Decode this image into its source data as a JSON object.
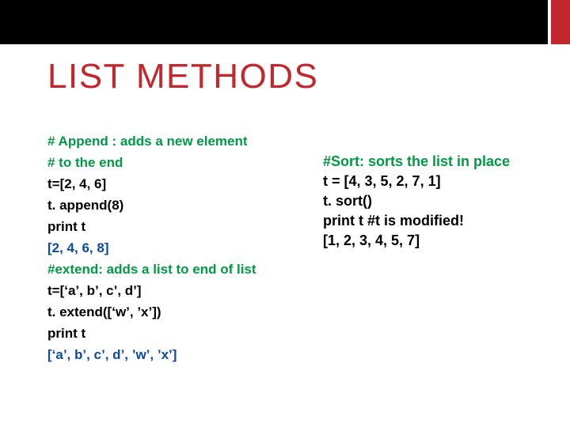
{
  "title": "LIST METHODS",
  "left": {
    "l0": "# Append  : adds a new element",
    "l1": "# to the end",
    "l2": "t=[2, 4, 6]",
    "l3": "t. append(8)",
    "l4": "print t",
    "l5": "[2, 4, 6, 8]",
    "l6": "#extend: adds a list to end of list",
    "l7": "t=[‘a’, b’, c’, d’]",
    "l8": "t. extend([‘w’, ’x’])",
    "l9": "print t",
    "l10": "[‘a’, b’, c’, d’, ’w’, ’x’]"
  },
  "right": {
    "r0": "#Sort: sorts the list in place",
    "r1": "t = [4, 3, 5, 2, 7, 1]",
    "r2": "t. sort()",
    "r3": "print t      #t is modified!",
    "r4": "[1, 2, 3, 4, 5, 7]"
  }
}
